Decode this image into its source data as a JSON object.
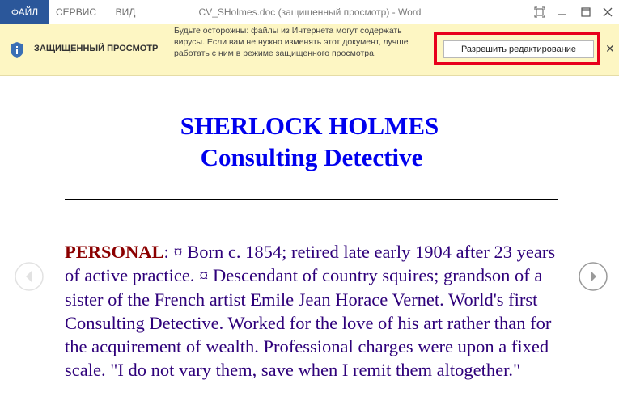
{
  "tabs": {
    "file": "ФАЙЛ",
    "service": "СЕРВИС",
    "view": "ВИД"
  },
  "window": {
    "title": "CV_SHolmes.doc (защищенный просмотр) - Word"
  },
  "protected_view": {
    "title": "ЗАЩИЩЕННЫЙ ПРОСМОТР",
    "message": "Будьте осторожны: файлы из Интернета могут содержать вирусы. Если вам не нужно изменять этот документ, лучше работать с ним в режиме защищенного просмотра.",
    "enable_button": "Разрешить редактирование",
    "close": "✕"
  },
  "document": {
    "heading_line1": "SHERLOCK HOLMES",
    "heading_line2": "Consulting Detective",
    "personal_label": "PERSONAL",
    "personal_text": ": ¤ Born c. 1854; retired late early 1904 after 23 years of active practice. ¤ Descendant of country squires; grandson of a sister of the French artist Emile Jean Horace Vernet. World's first Consulting Detective. Worked for the love of his art rather than for the acquirement of wealth. Professional charges were upon a fixed scale. \"I do not vary them, save when I remit them altogether.\""
  },
  "colors": {
    "file_tab": "#2b579a",
    "protected_bar": "#fdf6c3",
    "highlight": "#e8001c",
    "heading": "#0000ee",
    "body_text": "#2e007a",
    "lead_text": "#8b0000"
  }
}
